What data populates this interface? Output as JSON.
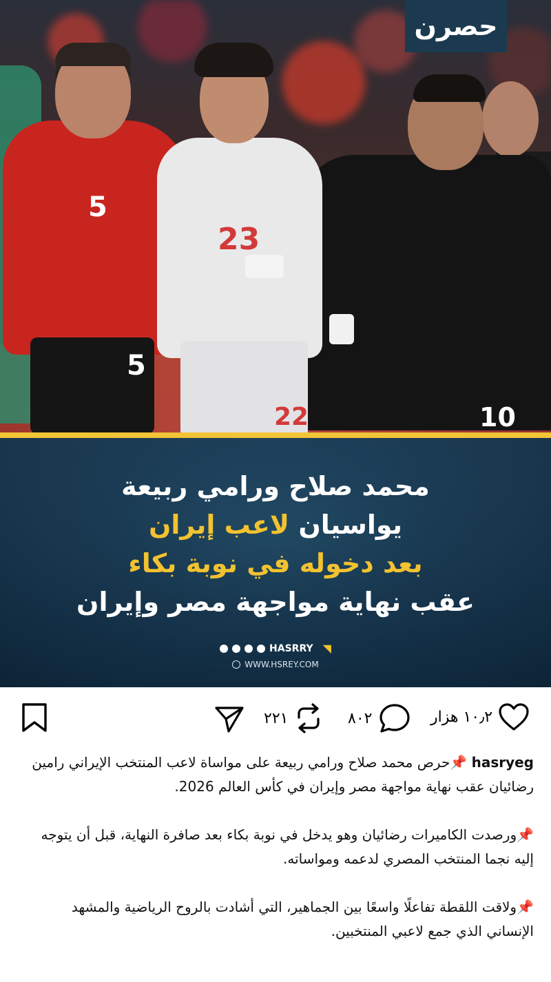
{
  "post": {
    "logo_text": "حصرن",
    "image": {
      "jersey_numbers": [
        "5",
        "5",
        "23",
        "22",
        "10"
      ]
    },
    "banner": {
      "line1": "محمد صلاح ورامي ربيعة",
      "line2_part1": "يواسيان",
      "line2_part2": "لاعب إيران",
      "line3": "بعد دخوله في نوبة بكاء",
      "line4": "عقب نهاية مواجهة مصر وإيران",
      "social_handle": "HASRRY",
      "website": "WWW.HSREY.COM"
    },
    "actions": {
      "likes": "١٠٫٢ هزار",
      "comments": "٨٠٢",
      "reposts": "٢٢١"
    },
    "caption": {
      "username": "hasryeg",
      "para1": "📌حرص محمد صلاح ورامي ربيعة على مواساة لاعب المنتخب الإيراني رامين رضائيان عقب نهاية مواجهة مصر وإيران في كأس العالم 2026.",
      "para2": "📌ورصدت الكاميرات رضائيان وهو يدخل في نوبة بكاء بعد صافرة النهاية، قبل أن يتوجه إليه نجما المنتخب المصري لدعمه ومواساته.",
      "para3": "📌ولاقت اللقطة تفاعلًا واسعًا بين الجماهير، التي أشادت بالروح الرياضية والمشهد الإنساني الذي جمع لاعبي المنتخبين."
    }
  },
  "colors": {
    "banner_bg": "#173a55",
    "accent_yellow": "#f2c230",
    "logo_bg": "#1b3a50"
  },
  "icons": [
    "heart-icon",
    "comment-icon",
    "repost-icon",
    "send-icon",
    "bookmark-icon",
    "globe-icon",
    "facebook-icon",
    "x-icon",
    "instagram-icon",
    "youtube-icon"
  ]
}
